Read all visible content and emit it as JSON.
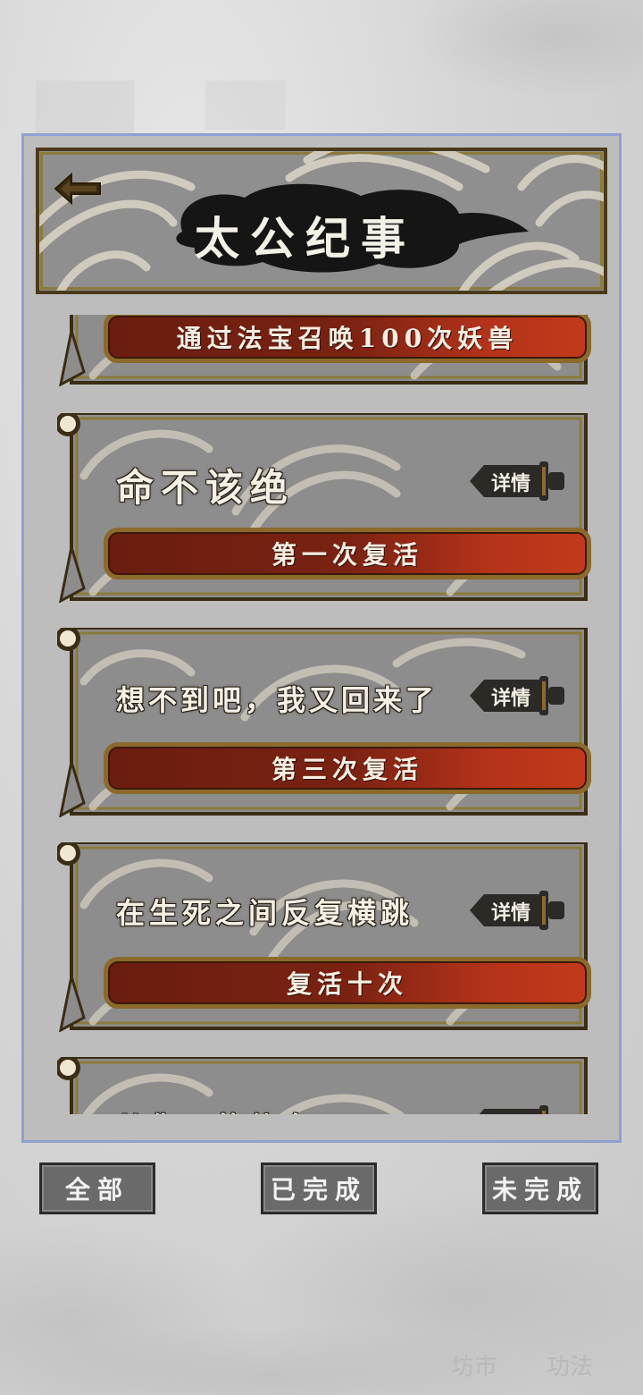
{
  "header": {
    "title": "太公纪事"
  },
  "achievements": [
    {
      "task": "通过法宝召唤100次妖兽"
    },
    {
      "title": "命不该绝",
      "detail_label": "详情",
      "task": "第一次复活"
    },
    {
      "title": "想不到吧，我又回来了",
      "detail_label": "详情",
      "task": "第三次复活"
    },
    {
      "title": "在生死之间反复横跳",
      "detail_label": "详情",
      "task": "复活十次"
    },
    {
      "title": "从你…的仙身",
      "detail_label": "详情"
    }
  ],
  "tabs": {
    "all": "全部",
    "completed": "已完成",
    "incomplete": "未完成"
  },
  "background_nav": {
    "market": "坊市",
    "skills": "功法"
  },
  "icons": {
    "back": "back-arrow-icon",
    "detail": "sword-tag-icon"
  },
  "colors": {
    "frame_border": "#8b7a3c",
    "bar_red": "#c23a1a",
    "panel_border": "#8ea2d0"
  }
}
